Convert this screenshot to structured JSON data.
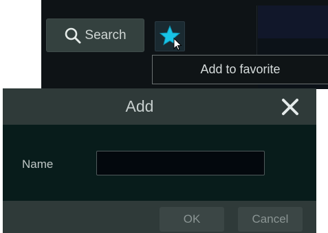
{
  "toolbar": {
    "search_label": "Search",
    "search_icon": "search-icon",
    "favorite_icon": "star-icon",
    "favorite_tooltip": "Add to favorite"
  },
  "dialog": {
    "title": "Add",
    "close_icon": "close-icon",
    "name_label": "Name",
    "name_value": "",
    "name_placeholder": "",
    "ok_label": "OK",
    "cancel_label": "Cancel"
  },
  "colors": {
    "star": "#18c3e6",
    "dialog_header": "#2f3a39",
    "dialog_body": "#081c1b",
    "toolbar_bg": "#0e1316"
  }
}
